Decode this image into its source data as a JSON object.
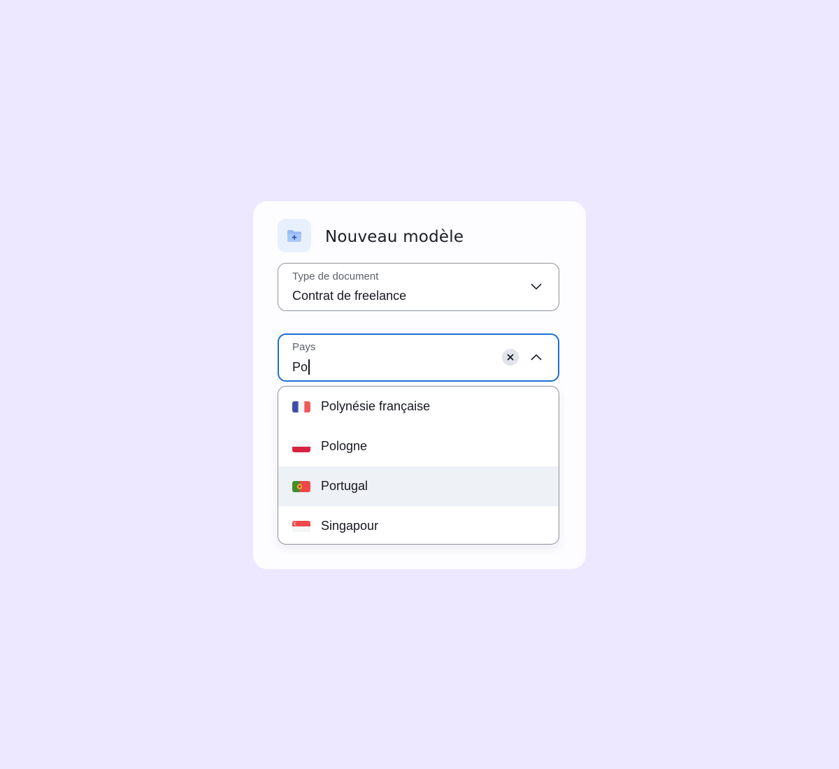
{
  "dialog": {
    "title": "Nouveau modèle",
    "header_icon": "folder-add-icon"
  },
  "document_type": {
    "label": "Type de document",
    "value": "Contrat de freelance",
    "icon": "chevron-down-icon"
  },
  "country": {
    "label": "Pays",
    "input_value": "Po",
    "clear_icon": "close-icon",
    "toggle_icon": "chevron-up-icon",
    "options": [
      {
        "label": "Polynésie française",
        "flag": "flag-france-icon",
        "highlighted": false
      },
      {
        "label": "Pologne",
        "flag": "flag-poland-icon",
        "highlighted": false
      },
      {
        "label": "Portugal",
        "flag": "flag-portugal-icon",
        "highlighted": true
      },
      {
        "label": "Singapour",
        "flag": "flag-singapore-icon",
        "highlighted": false
      }
    ]
  },
  "colors": {
    "background": "#ede7ff",
    "focus_border": "#1c6fd4",
    "highlight_row": "#eef1f5"
  }
}
